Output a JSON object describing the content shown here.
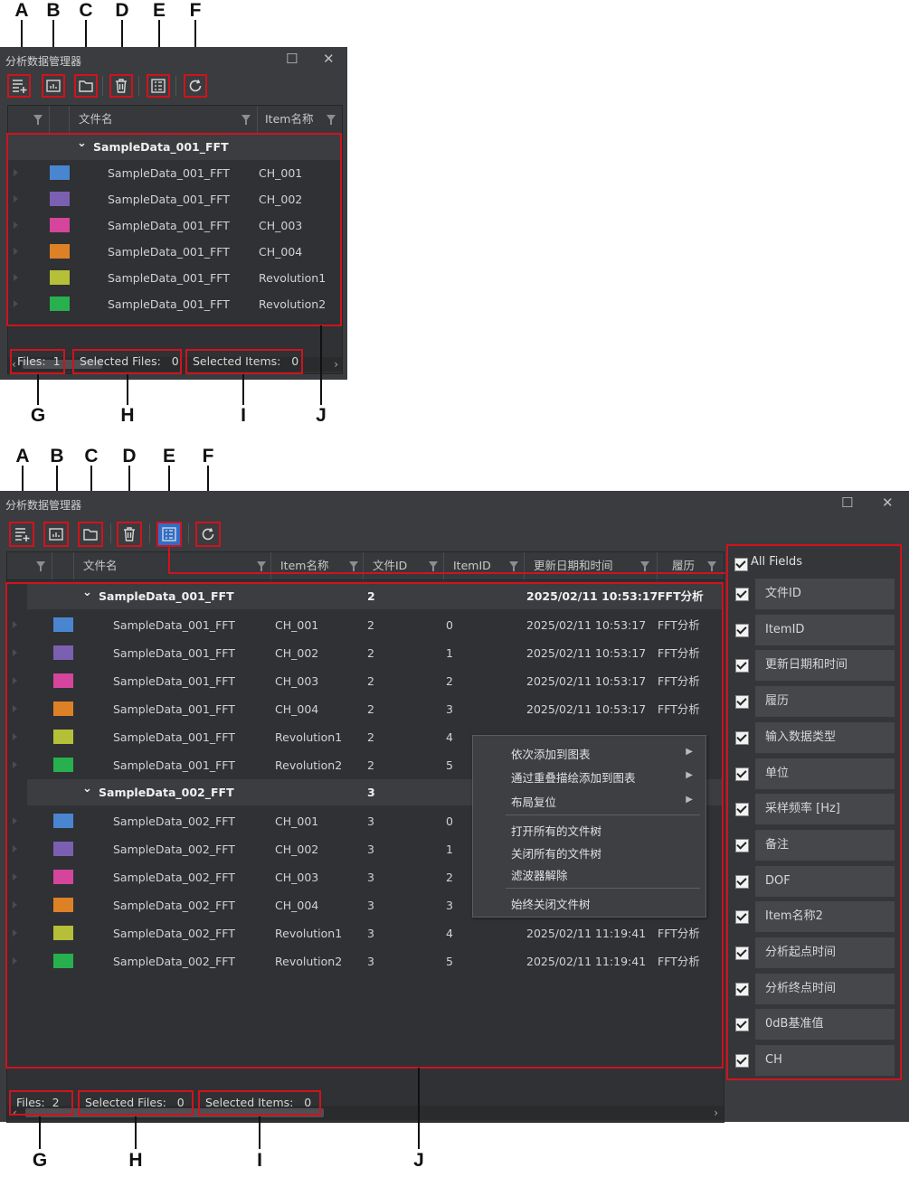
{
  "callouts_top": [
    "A",
    "B",
    "C",
    "D",
    "E",
    "F"
  ],
  "callouts_bottom": [
    "G",
    "H",
    "I",
    "J"
  ],
  "panel_title": "分析数据管理器",
  "window_controls": {
    "maximize": "☐",
    "close": "✕"
  },
  "toolbar_icons": [
    "add-to-list-icon",
    "overlay-chart-icon",
    "open-folder-icon",
    "delete-icon",
    "field-list-icon",
    "refresh-icon"
  ],
  "panel1": {
    "columns": {
      "file_name": "文件名",
      "item_name": "Item名称"
    },
    "group": "SampleData_001_FFT",
    "rows": [
      {
        "color": "#4a86d0",
        "file": "SampleData_001_FFT",
        "item": "CH_001"
      },
      {
        "color": "#7b5fb0",
        "file": "SampleData_001_FFT",
        "item": "CH_002"
      },
      {
        "color": "#d5459c",
        "file": "SampleData_001_FFT",
        "item": "CH_003"
      },
      {
        "color": "#dd8127",
        "file": "SampleData_001_FFT",
        "item": "CH_004"
      },
      {
        "color": "#b5bf37",
        "file": "SampleData_001_FFT",
        "item": "Revolution1"
      },
      {
        "color": "#27b04d",
        "file": "SampleData_001_FFT",
        "item": "Revolution2"
      }
    ],
    "status": {
      "files_label": "Files:",
      "files": "1",
      "sel_files_label": "Selected Files:",
      "sel_files": "0",
      "sel_items_label": "Selected Items:",
      "sel_items": "0"
    }
  },
  "panel2": {
    "columns": {
      "file_name": "文件名",
      "item_name": "Item名称",
      "file_id": "文件ID",
      "item_id": "ItemID",
      "updated": "更新日期和时间",
      "history": "履历"
    },
    "groups": [
      {
        "name": "SampleData_001_FFT",
        "file_id": "2",
        "date": "2025/02/11 10:53:17",
        "history": "FFT分析",
        "rows": [
          {
            "color": "#4a86d0",
            "file": "SampleData_001_FFT",
            "item": "CH_001",
            "fid": "2",
            "iid": "0",
            "date": "2025/02/11 10:53:17",
            "history": "FFT分析"
          },
          {
            "color": "#7b5fb0",
            "file": "SampleData_001_FFT",
            "item": "CH_002",
            "fid": "2",
            "iid": "1",
            "date": "2025/02/11 10:53:17",
            "history": "FFT分析"
          },
          {
            "color": "#d5459c",
            "file": "SampleData_001_FFT",
            "item": "CH_003",
            "fid": "2",
            "iid": "2",
            "date": "2025/02/11 10:53:17",
            "history": "FFT分析"
          },
          {
            "color": "#dd8127",
            "file": "SampleData_001_FFT",
            "item": "CH_004",
            "fid": "2",
            "iid": "3",
            "date": "2025/02/11 10:53:17",
            "history": "FFT分析"
          },
          {
            "color": "#b5bf37",
            "file": "SampleData_001_FFT",
            "item": "Revolution1",
            "fid": "2",
            "iid": "4",
            "date": "",
            "history": ""
          },
          {
            "color": "#27b04d",
            "file": "SampleData_001_FFT",
            "item": "Revolution2",
            "fid": "2",
            "iid": "5",
            "date": "",
            "history": ""
          }
        ]
      },
      {
        "name": "SampleData_002_FFT",
        "file_id": "3",
        "date": "",
        "history": "",
        "rows": [
          {
            "color": "#4a86d0",
            "file": "SampleData_002_FFT",
            "item": "CH_001",
            "fid": "3",
            "iid": "0",
            "date": "",
            "history": ""
          },
          {
            "color": "#7b5fb0",
            "file": "SampleData_002_FFT",
            "item": "CH_002",
            "fid": "3",
            "iid": "1",
            "date": "",
            "history": ""
          },
          {
            "color": "#d5459c",
            "file": "SampleData_002_FFT",
            "item": "CH_003",
            "fid": "3",
            "iid": "2",
            "date": "",
            "history": ""
          },
          {
            "color": "#dd8127",
            "file": "SampleData_002_FFT",
            "item": "CH_004",
            "fid": "3",
            "iid": "3",
            "date": "",
            "history": ""
          },
          {
            "color": "#b5bf37",
            "file": "SampleData_002_FFT",
            "item": "Revolution1",
            "fid": "3",
            "iid": "4",
            "date": "2025/02/11 11:19:41",
            "history": "FFT分析"
          },
          {
            "color": "#27b04d",
            "file": "SampleData_002_FFT",
            "item": "Revolution2",
            "fid": "3",
            "iid": "5",
            "date": "2025/02/11 11:19:41",
            "history": "FFT分析"
          }
        ]
      }
    ],
    "context_menu": [
      {
        "label": "依次添加到图表",
        "submenu": true
      },
      {
        "label": "通过重叠描绘添加到图表",
        "submenu": true
      },
      {
        "label": "布局复位",
        "submenu": true
      },
      {
        "label": "打开所有的文件树",
        "submenu": false
      },
      {
        "label": "关闭所有的文件树",
        "submenu": false
      },
      {
        "label": "滤波器解除",
        "submenu": false
      },
      {
        "label": "始终关闭文件树",
        "submenu": false
      }
    ],
    "fields_panel": {
      "all_label": "All Fields",
      "items": [
        "文件ID",
        "ItemID",
        "更新日期和时间",
        "履历",
        "输入数据类型",
        "单位",
        "采样频率 [Hz]",
        "备注",
        "DOF",
        "Item名称2",
        "分析起点时间",
        "分析终点时间",
        "0dB基准值",
        "CH"
      ]
    },
    "status": {
      "files_label": "Files:",
      "files": "2",
      "sel_files_label": "Selected Files:",
      "sel_files": "0",
      "sel_items_label": "Selected Items:",
      "sel_items": "0"
    }
  }
}
